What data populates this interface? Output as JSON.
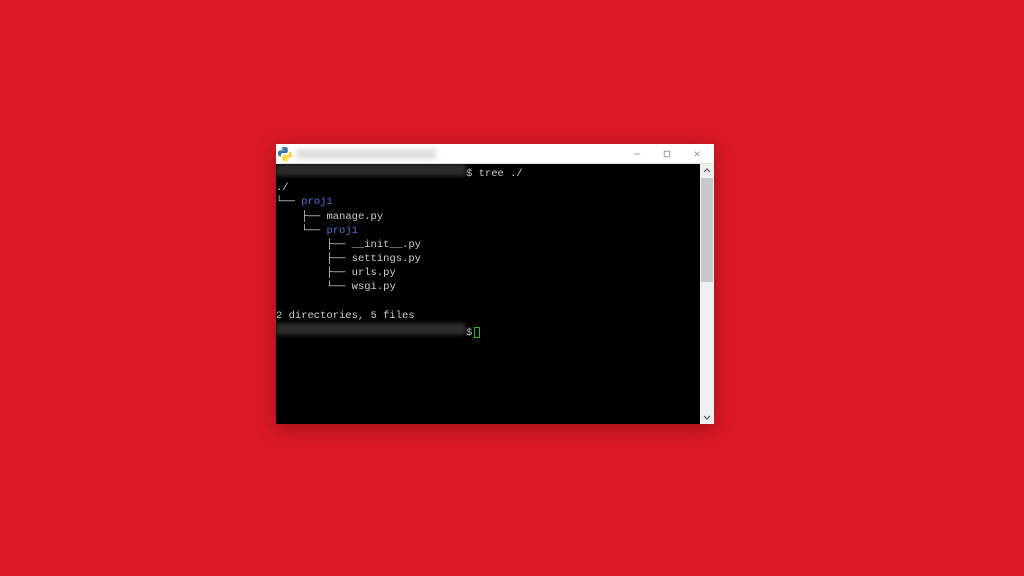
{
  "window": {
    "title_placeholder": "",
    "buttons": {
      "minimize": "",
      "maximize": "",
      "close": ""
    }
  },
  "terminal": {
    "prompt1": {
      "symbol": "$",
      "command": "tree ./"
    },
    "tree": {
      "root": "./",
      "l1_dir": "proj1",
      "l2_file_manage": "manage.py",
      "l2_dir": "proj1",
      "l3_init": "__init__.py",
      "l3_settings": "settings.py",
      "l3_urls": "urls.py",
      "l3_wsgi": "wsgi.py"
    },
    "summary": "2 directories, 5 files",
    "prompt2": {
      "symbol": "$"
    }
  },
  "glyphs": {
    "tree_branch": "├──",
    "tree_last": "└──",
    "tree_pipe": "│  "
  }
}
